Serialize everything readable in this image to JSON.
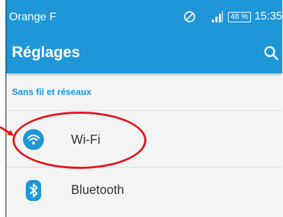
{
  "status_bar": {
    "carrier": "Orange F",
    "battery": "48 %",
    "time": "15:35"
  },
  "app_bar": {
    "title": "Réglages"
  },
  "settings": {
    "section_header": "Sans fil et réseaux",
    "items": [
      {
        "label": "Wi-Fi",
        "icon": "wifi-icon"
      },
      {
        "label": "Bluetooth",
        "icon": "bluetooth-icon"
      }
    ]
  },
  "colors": {
    "accent": "#1e96d8",
    "annotation": "#e5141b",
    "background": "#f4f4f4"
  }
}
